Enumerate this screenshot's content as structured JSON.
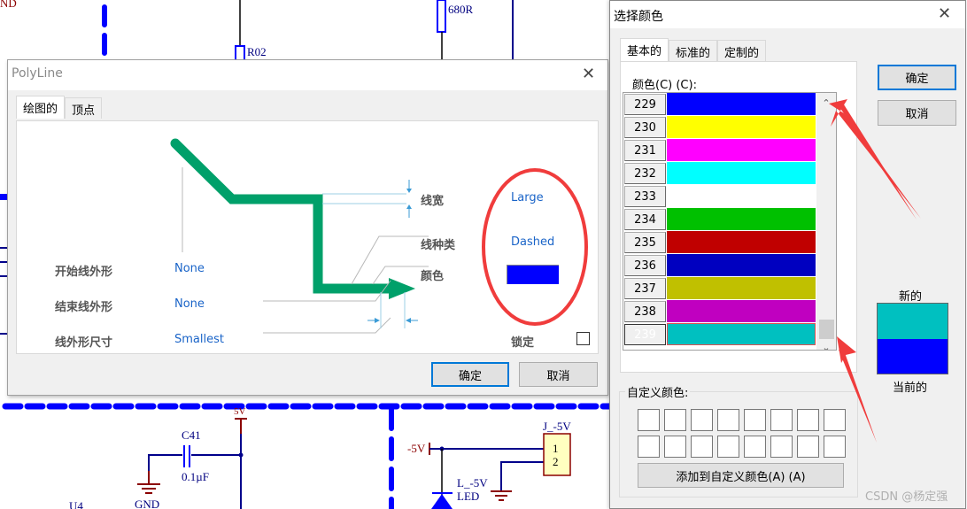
{
  "schematic": {
    "labels": {
      "gnd_top": "ND",
      "r02": "R02",
      "r680": "680R",
      "v5": "5V",
      "c41": "C41",
      "c41_val": "0.1µF",
      "gnd": "GND",
      "u4": "U4",
      "neg5v": "-5V",
      "j_neg5v": "J_-5V",
      "pin1": "1",
      "pin2": "2",
      "led_name": "L_-5V",
      "led": "LED"
    },
    "colors": {
      "wire": "#00008b",
      "dash": "#0000ff",
      "power": "#8b0000",
      "connector": "#ffffc0"
    }
  },
  "polyline_dialog": {
    "title": "PolyLine",
    "close_icon": "close-icon",
    "tabs": [
      {
        "label": "绘图的",
        "active": true
      },
      {
        "label": "顶点",
        "active": false
      }
    ],
    "properties": {
      "line_width": {
        "label": "线宽",
        "value": "Large"
      },
      "line_style": {
        "label": "线种类",
        "value": "Dashed"
      },
      "color": {
        "label": "颜色",
        "value": "#0000ff"
      },
      "start_shape": {
        "label": "开始线外形",
        "value": "None"
      },
      "end_shape": {
        "label": "结束线外形",
        "value": "None"
      },
      "shape_size": {
        "label": "线外形尺寸",
        "value": "Smallest"
      },
      "locked": {
        "label": "锁定",
        "checked": false
      }
    },
    "preview_line_color": "#00a06a",
    "annotation_color": "#e8383d",
    "buttons": {
      "ok": "确定",
      "cancel": "取消"
    }
  },
  "color_dialog": {
    "title": "选择颜色",
    "close_icon": "close-icon",
    "tabs": [
      {
        "label": "基本的",
        "active": true
      },
      {
        "label": "标准的",
        "active": false
      },
      {
        "label": "定制的",
        "active": false
      }
    ],
    "list_label": "颜色(C) (C):",
    "colors": [
      {
        "index": "229",
        "hex": "#0000ff"
      },
      {
        "index": "230",
        "hex": "#ffff00"
      },
      {
        "index": "231",
        "hex": "#ff00ff"
      },
      {
        "index": "232",
        "hex": "#00ffff"
      },
      {
        "index": "233",
        "hex": "#ffffff"
      },
      {
        "index": "234",
        "hex": "#00c000"
      },
      {
        "index": "235",
        "hex": "#c00000"
      },
      {
        "index": "236",
        "hex": "#0000c0"
      },
      {
        "index": "237",
        "hex": "#c0c000"
      },
      {
        "index": "238",
        "hex": "#c000c0"
      },
      {
        "index": "239",
        "hex": "#00c0c0",
        "selected": true
      }
    ],
    "buttons": {
      "ok": "确定",
      "cancel": "取消",
      "add_custom": "添加到自定义颜色(A) (A)"
    },
    "custom_colors_label": "自定义颜色:",
    "custom_colors_count": 16,
    "new_label": "新的",
    "new_color": "#00c0c0",
    "current_label": "当前的",
    "current_color": "#0000ff"
  },
  "watermark": "CSDN @杨定强"
}
